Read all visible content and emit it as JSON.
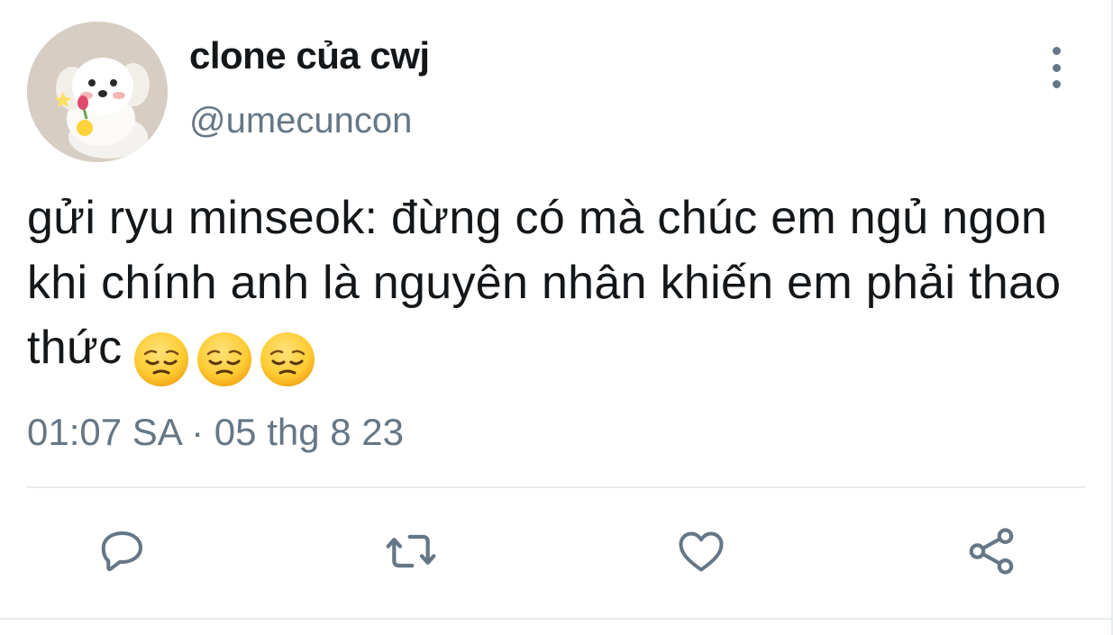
{
  "author": {
    "display_name": "clone của cwj",
    "handle": "@umecuncon",
    "avatar_icon": "puppy-avatar"
  },
  "tweet": {
    "text": "gửi ryu minseok: đừng có mà chúc em ngủ ngon khi chính anh là nguyên nhân khiến em phải thao thức",
    "emojis": [
      "pensive-face-emoji",
      "pensive-face-emoji",
      "pensive-face-emoji"
    ],
    "timestamp": "01:07 SA · 05 thg 8 23"
  },
  "actions": {
    "reply_icon": "reply-icon",
    "retweet_icon": "retweet-icon",
    "like_icon": "heart-icon",
    "share_icon": "share-icon",
    "more_icon": "more-vertical-icon"
  },
  "colors": {
    "text_primary": "#14171a",
    "text_secondary": "#657786",
    "divider": "#e6ecf0",
    "emoji_yellow": "#ffcc33"
  }
}
